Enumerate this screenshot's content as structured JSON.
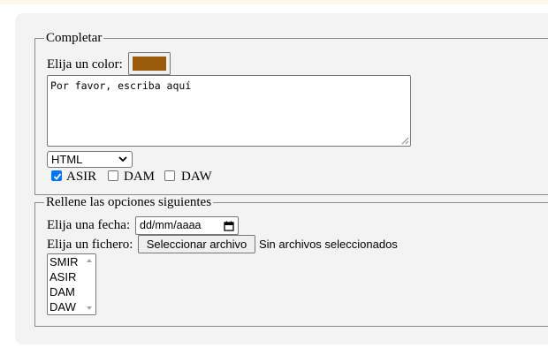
{
  "section_completar": {
    "legend": "Completar",
    "color_label": "Elija un color:",
    "color_value": "#9a5b0a",
    "textarea_text": "Por favor, escriba aquí",
    "select_value": "HTML",
    "checkboxes": [
      {
        "label": "ASIR",
        "checked": true
      },
      {
        "label": "DAM",
        "checked": false
      },
      {
        "label": "DAW",
        "checked": false
      }
    ]
  },
  "section_opciones": {
    "legend": "Rellene las opciones siguientes",
    "date_label": "Elija una fecha:",
    "date_placeholder": "dd/mm/aaaa",
    "file_label": "Elija un fichero:",
    "file_button": "Seleccionar archivo",
    "file_status": "Sin archivos seleccionados",
    "list_options": [
      "SMIR",
      "ASIR",
      "DAM",
      "DAW"
    ]
  },
  "colors": {
    "accent_checkbox": "#0075ff",
    "panel_background": "#f3f3f3"
  }
}
